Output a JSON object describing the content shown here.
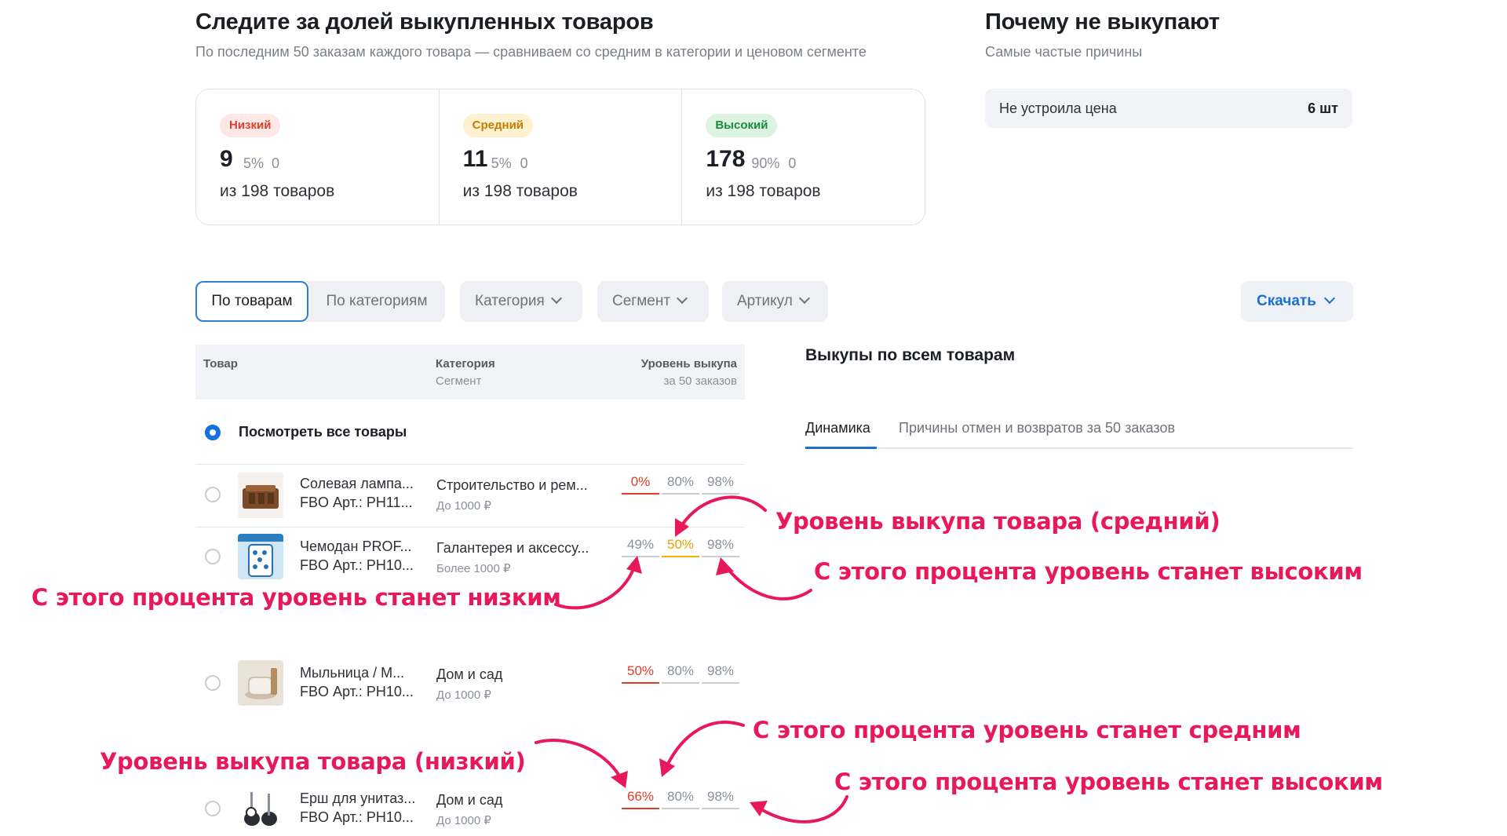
{
  "header": {
    "title": "Следите за долей выкупленных товаров",
    "subtitle": "По последним 50 заказам каждого товара — сравниваем со средним в категории и ценовом сегменте"
  },
  "levels": [
    {
      "label": "Низкий",
      "count": "9",
      "percent": "5%",
      "delta": "0",
      "of": "из 198 товаров",
      "color": "#d9412e"
    },
    {
      "label": "Средний",
      "count": "11",
      "percent": "5%",
      "delta": "0",
      "of": "из 198 товаров",
      "color": "#c47d00"
    },
    {
      "label": "Высокий",
      "count": "178",
      "percent": "90%",
      "delta": "0",
      "of": "из 198 товаров",
      "color": "#1e8a3e"
    }
  ],
  "reasons": {
    "title": "Почему не выкупают",
    "subtitle": "Самые частые причины",
    "items": [
      {
        "label": "Не устроила цена",
        "count": "6 шт"
      }
    ]
  },
  "filters": {
    "by_products": "По товарам",
    "by_categories": "По категориям",
    "category": "Категория",
    "segment": "Сегмент",
    "article": "Артикул",
    "download": "Скачать"
  },
  "table": {
    "col_product": "Товар",
    "col_category": "Категория",
    "col_segment": "Сегмент",
    "col_level": "Уровень выкупа",
    "col_level_sub": "за 50 заказов",
    "view_all": "Посмотреть все товары",
    "rows": [
      {
        "name": "Солевая лампа...",
        "sku": "FBO Арт.: PH11...",
        "category": "Строительство и рем...",
        "segment": "До 1000 ₽",
        "level": "0%",
        "mid": "80%",
        "high": "98%",
        "state": "low"
      },
      {
        "name": "Чемодан PROF...",
        "sku": "FBO Арт.: PH10...",
        "category": "Галантерея и аксессу...",
        "segment": "Более 1000 ₽",
        "level": "49%",
        "mid": "50%",
        "high": "98%",
        "state": "mid"
      },
      {
        "name": "Мыльница / М...",
        "sku": "FBO Арт.: PH10...",
        "category": "Дом и сад",
        "segment": "До 1000 ₽",
        "level": "50%",
        "mid": "80%",
        "high": "98%",
        "state": "low"
      },
      {
        "name": "Ерш для унитаз...",
        "sku": "FBO Арт.: PH10...",
        "category": "Дом и сад",
        "segment": "До 1000 ₽",
        "level": "66%",
        "mid": "80%",
        "high": "98%",
        "state": "low"
      }
    ]
  },
  "panel": {
    "title": "Выкупы по всем товарам",
    "tabs": [
      "Динамика",
      "Причины отмен и возвратов за 50 заказов"
    ]
  },
  "annotations": {
    "row2_current": "Уровень выкупа товара (средний)",
    "row2_high": "С этого процента уровень станет высоким",
    "row2_low": "С этого процента уровень станет низким",
    "row4_mid": "С этого процента уровень станет средним",
    "row4_current": "Уровень выкупа товара (низкий)",
    "row4_high": "С этого процента уровень станет высоким",
    "color": "#e8195a"
  }
}
